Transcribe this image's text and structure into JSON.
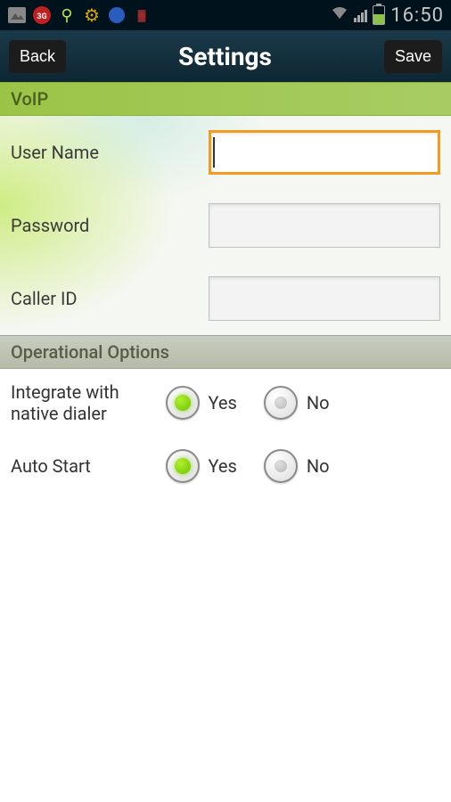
{
  "status": {
    "time": "16:50"
  },
  "header": {
    "title": "Settings",
    "back_label": "Back",
    "save_label": "Save"
  },
  "voip": {
    "section_title": "VoIP",
    "username_label": "User Name",
    "username_value": "",
    "password_label": "Password",
    "password_value": "",
    "callerid_label": "Caller ID",
    "callerid_value": ""
  },
  "options": {
    "section_title": "Operational Options",
    "integrate_label": "Integrate with native dialer",
    "autostart_label": "Auto Start",
    "yes_label": "Yes",
    "no_label": "No",
    "integrate_value": "yes",
    "autostart_value": "yes"
  }
}
